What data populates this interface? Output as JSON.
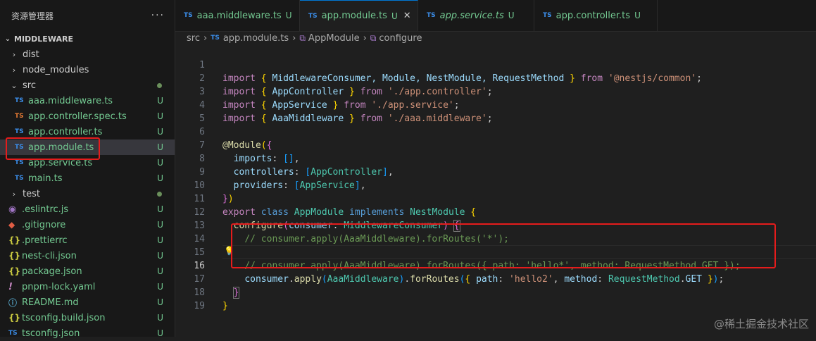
{
  "sidebar": {
    "title": "资源管理器",
    "more": "···",
    "section": "MIDDLEWARE",
    "items": [
      {
        "name": "dist",
        "type": "folder"
      },
      {
        "name": "node_modules",
        "type": "folder"
      },
      {
        "name": "src",
        "type": "folder-open"
      },
      {
        "name": "aaa.middleware.ts",
        "icon": "TS",
        "status": "U"
      },
      {
        "name": "app.controller.spec.ts",
        "icon": "TS",
        "status": "U"
      },
      {
        "name": "app.controller.ts",
        "icon": "TS",
        "status": "U"
      },
      {
        "name": "app.module.ts",
        "icon": "TS",
        "status": "U"
      },
      {
        "name": "app.service.ts",
        "icon": "TS",
        "status": "U"
      },
      {
        "name": "main.ts",
        "icon": "TS",
        "status": "U"
      },
      {
        "name": "test",
        "type": "folder"
      },
      {
        "name": ".eslintrc.js",
        "icon": "◉",
        "status": "U"
      },
      {
        "name": ".gitignore",
        "icon": "◆",
        "status": "U"
      },
      {
        "name": ".prettierrc",
        "icon": "{}",
        "status": "U"
      },
      {
        "name": "nest-cli.json",
        "icon": "{}",
        "status": "U"
      },
      {
        "name": "package.json",
        "icon": "{}",
        "status": "U"
      },
      {
        "name": "pnpm-lock.yaml",
        "icon": "!",
        "status": "U"
      },
      {
        "name": "README.md",
        "icon": "ⓘ",
        "status": "U"
      },
      {
        "name": "tsconfig.build.json",
        "icon": "{}",
        "status": "U"
      },
      {
        "name": "tsconfig.json",
        "icon": "TS",
        "status": "U"
      }
    ]
  },
  "tabs": [
    {
      "icon": "TS",
      "label": "aaa.middleware.ts",
      "status": "U"
    },
    {
      "icon": "TS",
      "label": "app.module.ts",
      "status": "U",
      "close": "✕"
    },
    {
      "icon": "TS",
      "label": "app.service.ts",
      "status": "U"
    },
    {
      "icon": "TS",
      "label": "app.controller.ts",
      "status": "U"
    }
  ],
  "breadcrumb": {
    "folder": "src",
    "file_icon": "TS",
    "file": "app.module.ts",
    "symbol1": "AppModule",
    "symbol2": "configure"
  },
  "code": {
    "line_numbers": [
      "1",
      "2",
      "3",
      "4",
      "5",
      "6",
      "7",
      "8",
      "9",
      "10",
      "11",
      "12",
      "13",
      "14",
      "15",
      "16",
      "17",
      "18",
      "19"
    ],
    "l1": {
      "import": "import",
      "names": " MiddlewareConsumer, Module, NestModule, RequestMethod ",
      "from": "from",
      "src": "'@nestjs/common'"
    },
    "l2": {
      "import": "import",
      "name": "AppController",
      "from": "from",
      "src": "'./app.controller'"
    },
    "l3": {
      "import": "import",
      "name": "AppService",
      "from": "from",
      "src": "'./app.service'"
    },
    "l4": {
      "import": "import",
      "name": "AaaMiddleware",
      "from": "from",
      "src": "'./aaa.middleware'"
    },
    "l6": {
      "decorator": "@Module"
    },
    "l7": {
      "key": "imports",
      "val": "[]"
    },
    "l8": {
      "key": "controllers",
      "val": "AppController"
    },
    "l9": {
      "key": "providers",
      "val": "AppService"
    },
    "l11": {
      "export": "export",
      "class": "class",
      "name": "AppModule",
      "implements": "implements",
      "iface": "NestModule"
    },
    "l12": {
      "fn": "configure",
      "param": "consumer",
      "type": "MiddlewareConsumer"
    },
    "l13": {
      "comment": "// consumer.apply(AaaMiddleware).forRoutes('*');"
    },
    "l15": {
      "comment": "// consumer.apply(AaaMiddleware).forRoutes({ path: 'hello*', method: RequestMethod.GET });"
    },
    "l16": {
      "obj": "consumer",
      "apply": "apply",
      "arg": "AaaMiddleware",
      "forRoutes": "forRoutes",
      "path_key": "path",
      "path_val": "'hello2'",
      "method_key": "method",
      "method_obj": "RequestMethod",
      "method_prop": "GET"
    }
  },
  "watermark": "@稀土掘金技术社区"
}
